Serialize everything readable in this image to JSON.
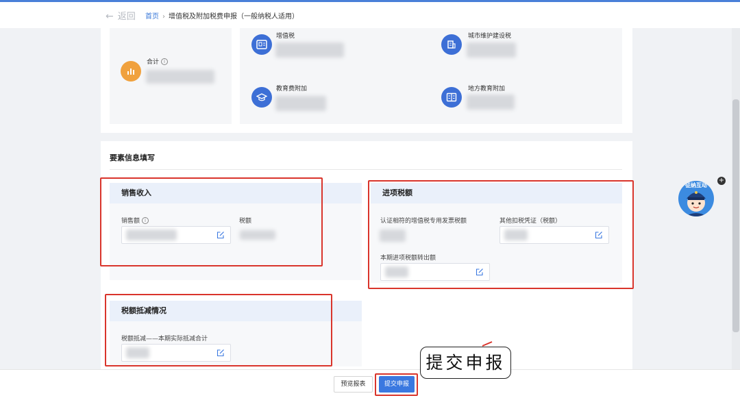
{
  "header": {
    "back_label": "返回",
    "breadcrumb_home": "首页",
    "breadcrumb_current": "增值税及附加税费申报（一般纳税人适用）"
  },
  "summary": {
    "total_label": "合计",
    "items": [
      {
        "label": "增值税",
        "icon": "tax-doc-icon"
      },
      {
        "label": "城市维护建设税",
        "icon": "building-icon"
      },
      {
        "label": "教育费附加",
        "icon": "graduation-cap-icon"
      },
      {
        "label": "地方教育附加",
        "icon": "book-icon"
      }
    ]
  },
  "section": {
    "title": "要素信息填写"
  },
  "sales": {
    "title": "销售收入",
    "sales_amount_label": "销售额",
    "tax_label": "税额"
  },
  "input_tax": {
    "title": "进项税额",
    "certified_label": "认证相符的增值税专用发票税额",
    "other_label": "其他扣税凭证（税额）",
    "transfer_label": "本期进项税额转出额"
  },
  "deduction": {
    "title": "税额抵减情况",
    "field_label": "税额抵减——本期实际抵减合计"
  },
  "footer": {
    "preview_label": "预览报表",
    "submit_label": "提交申报"
  },
  "callout": {
    "text": "提交申报"
  },
  "mascot": {
    "text": "征纳互动"
  },
  "colors": {
    "accent": "#3a78e0",
    "highlight": "#d9342b",
    "total_icon": "#f0a13e"
  }
}
